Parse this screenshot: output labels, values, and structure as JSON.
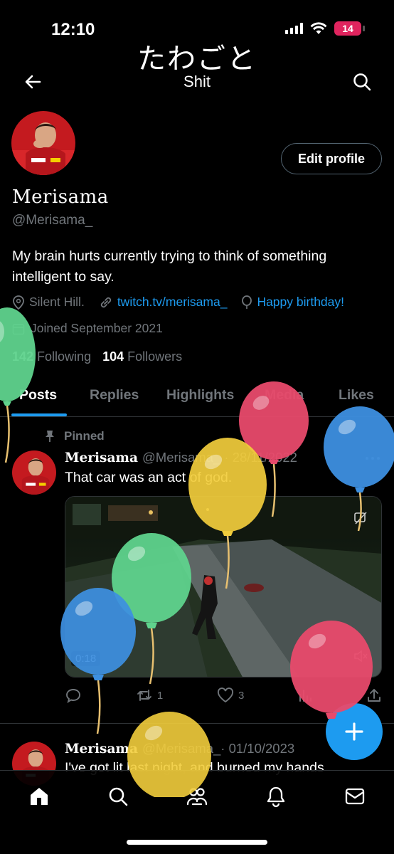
{
  "status_bar": {
    "time": "12:10",
    "battery": "14"
  },
  "header": {
    "account_title": "たわごと",
    "list_title": "Shit"
  },
  "profile": {
    "edit_label": "Edit profile",
    "display_name": "Merisama",
    "handle": "@Merisama_",
    "bio": "My brain hurts currently trying to think of something intelligent to say.",
    "location": "Silent Hill.",
    "website": "twitch.tv/merisama_",
    "birthday": "Happy birthday!",
    "joined": "Joined September 2021",
    "following_count": "142",
    "following_label": "Following",
    "followers_count": "104",
    "followers_label": "Followers"
  },
  "tabs": [
    "Posts",
    "Replies",
    "Highlights",
    "Media",
    "Likes"
  ],
  "posts": [
    {
      "pinned_label": "Pinned",
      "name": "Merisama",
      "handle": "@Merisama_",
      "date": "· 28/11/2022",
      "text": "That car was an act of god.",
      "video_duration": "0:18",
      "retweets": "1",
      "likes": "3"
    },
    {
      "name": "Merisama",
      "handle": "@Merisama_",
      "date": "· 01/10/2023",
      "text": "I've got lit last night, and burned my hands"
    }
  ],
  "colors": {
    "accent": "#1d9bf0",
    "battery": "#e0245e",
    "balloon_green": "#5fd38d",
    "balloon_red": "#e84a6b",
    "balloon_yellow": "#f2cd3c",
    "balloon_blue": "#3d8fe0"
  },
  "icons": [
    "back-arrow-icon",
    "search-icon",
    "location-pin-icon",
    "link-icon",
    "balloon-icon",
    "calendar-icon",
    "pin-icon",
    "reply-icon",
    "retweet-icon",
    "heart-icon",
    "views-icon",
    "share-icon",
    "compose-plus-icon",
    "home-icon",
    "explore-icon",
    "communities-icon",
    "notifications-icon",
    "messages-icon"
  ]
}
